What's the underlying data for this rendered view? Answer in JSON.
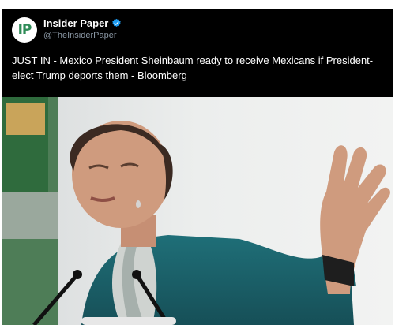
{
  "tweet": {
    "avatar_initials": "IP",
    "display_name": "Insider Paper",
    "verified_icon": "verified-badge-icon",
    "handle": "@TheInsiderPaper",
    "text": "JUST IN - Mexico President Sheinbaum ready to receive Mexicans if President-elect Trump deports them - Bloomberg"
  },
  "colors": {
    "header_bg": "#000000",
    "text": "#ffffff",
    "handle": "#8b98a5",
    "verified": "#1d9bf0",
    "avatar_accent": "#2e8b57"
  }
}
